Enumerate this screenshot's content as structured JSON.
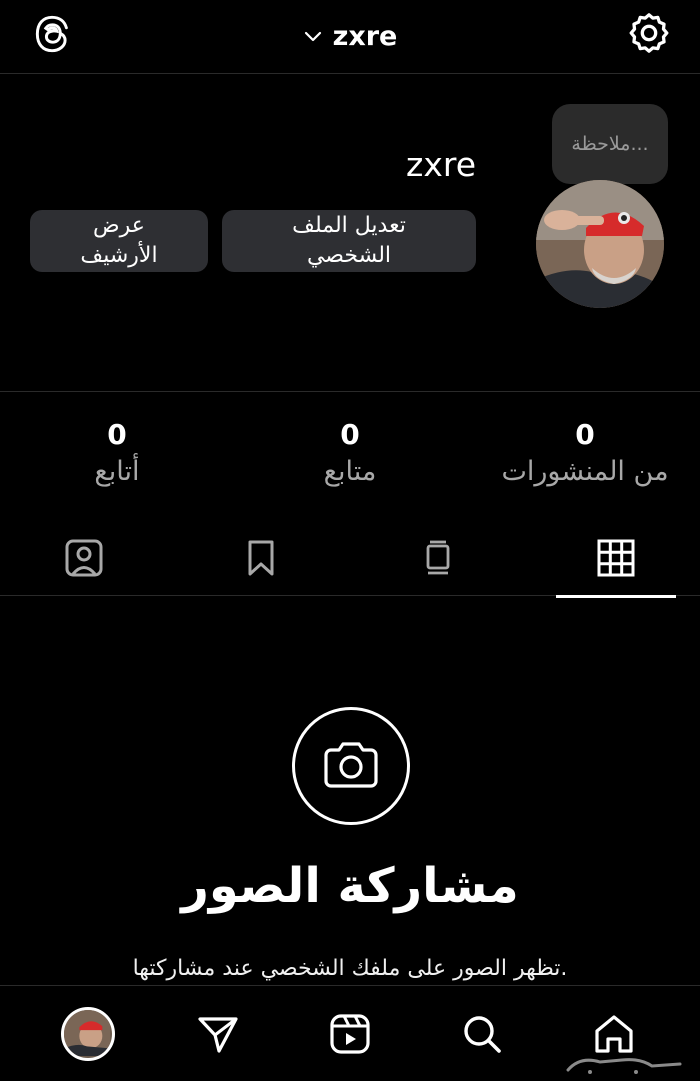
{
  "header": {
    "account_name": "zxre",
    "icons": {
      "left": "threads-icon",
      "switch": "chevron-down-icon",
      "right": "settings-icon"
    }
  },
  "profile": {
    "note_placeholder": "ملاحظة...",
    "username": "zxre",
    "edit_profile_label": "تعديل الملف\nالشخصي",
    "view_archive_label": "عرض\nالأرشيف"
  },
  "stats": {
    "posts": {
      "value": "0",
      "label": "من المنشورات"
    },
    "followers": {
      "value": "0",
      "label": "متابع"
    },
    "following": {
      "value": "0",
      "label": "أتابع"
    }
  },
  "tabs": [
    {
      "icon": "grid-icon",
      "active": true
    },
    {
      "icon": "reels-feed-icon",
      "active": false
    },
    {
      "icon": "bookmark-icon",
      "active": false
    },
    {
      "icon": "tagged-person-icon",
      "active": false
    }
  ],
  "empty_state": {
    "icon": "camera-icon",
    "title": "مشاركة الصور",
    "subtitle": "تظهر الصور على ملفك الشخصي عند مشاركتها."
  },
  "bottom_nav": {
    "items": [
      "home-icon",
      "search-icon",
      "reels-icon",
      "share-icon",
      "profile-avatar"
    ]
  },
  "colors": {
    "background": "#000000",
    "button_bg": "#2e2f33",
    "muted_text": "#a8a8a8",
    "divider": "#2a2a2a"
  }
}
